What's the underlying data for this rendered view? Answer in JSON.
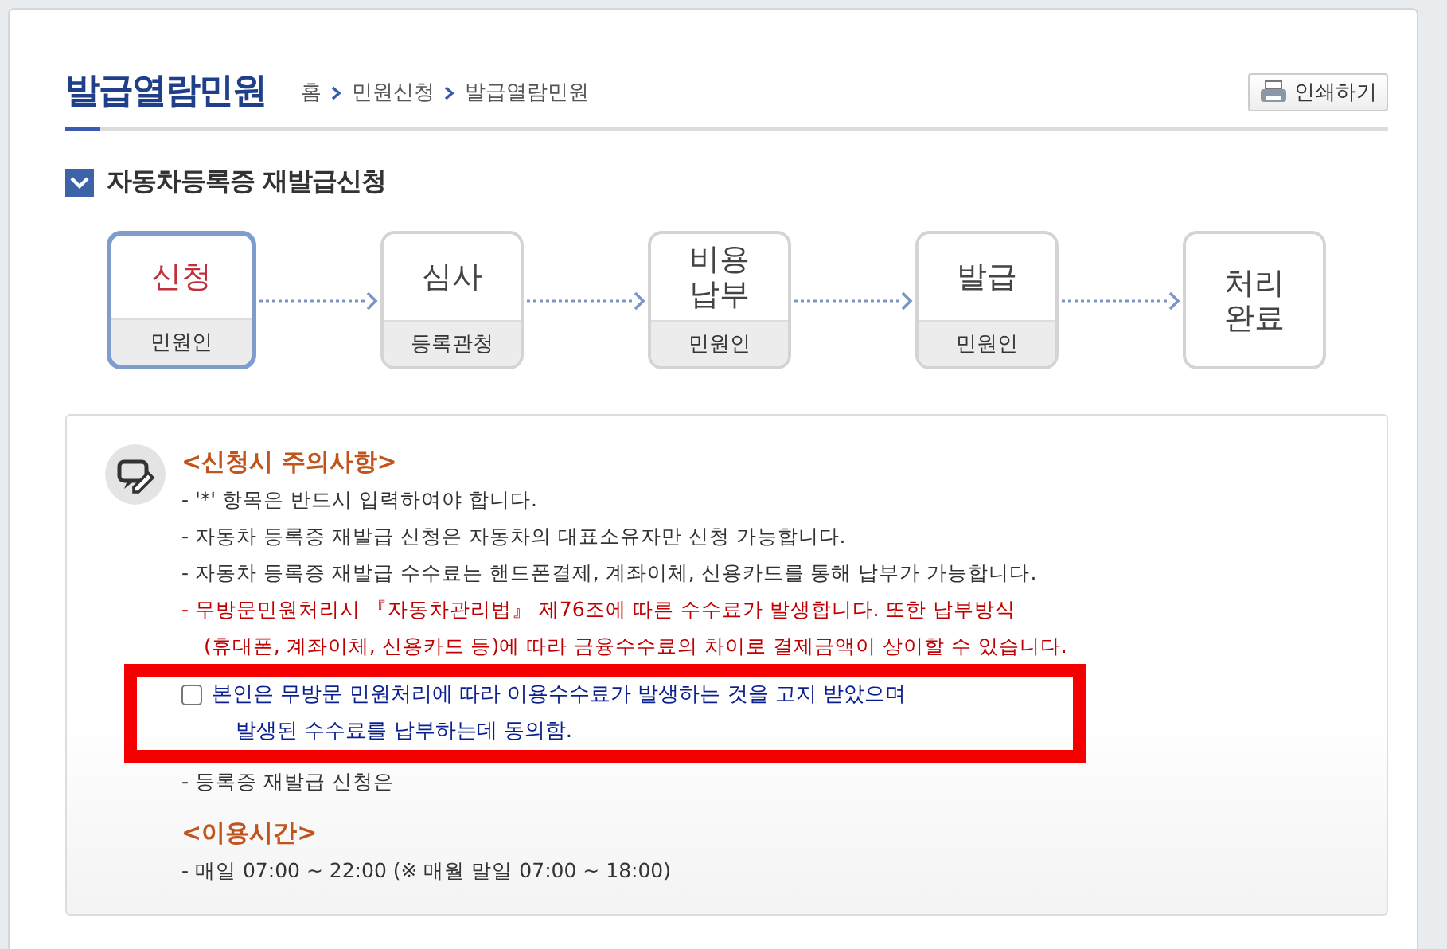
{
  "header": {
    "title": "발급열람민원",
    "breadcrumb": [
      "홈",
      "민원신청",
      "발급열람민원"
    ],
    "print_button": "인쇄하기"
  },
  "section_title": "자동차등록증 재발급신청",
  "steps": [
    {
      "label": "신청",
      "sub": "민원인",
      "selected": true
    },
    {
      "label": "심사",
      "sub": "등록관청",
      "selected": false
    },
    {
      "label": "비용\n납부",
      "sub": "민원인",
      "selected": false
    },
    {
      "label": "발급",
      "sub": "민원인",
      "selected": false
    },
    {
      "label": "처리\n완료",
      "selected": false
    }
  ],
  "notice": {
    "title": "<신청시 주의사항>",
    "items": [
      {
        "kind": "normal",
        "text": "- '*' 항목은 반드시 입력하여야 합니다."
      },
      {
        "kind": "normal",
        "text": "- 자동차 등록증 재발급 신청은 자동차의 대표소유자만 신청 가능합니다."
      },
      {
        "kind": "normal",
        "text": "- 자동차 등록증 재발급 수수료는 핸드폰결제, 계좌이체, 신용카드를 통해 납부가 가능합니다."
      },
      {
        "kind": "warning",
        "text": "- 무방문민원처리시 『자동차관리법』 제76조에 따른 수수료가 발생합니다. 또한 납부방식"
      },
      {
        "kind": "warning",
        "text": "(휴대폰, 계좌이체, 신용카드 등)에 따라 금융수수료의 차이로 결제금액이 상이할 수 있습니다."
      }
    ],
    "agreement": {
      "checked": false,
      "lines": [
        "본인은 무방문 민원처리에 따라 이용수수료가 발생하는 것을 고지 받았으며",
        "발생된 수수료를 납부하는데 동의함."
      ]
    },
    "after": "- 등록증 재발급 신청은",
    "hours_title": "<이용시간>",
    "hours": "- 매일 07:00 ~ 22:00 (※ 매월 말일 07:00 ~ 18:00)"
  }
}
